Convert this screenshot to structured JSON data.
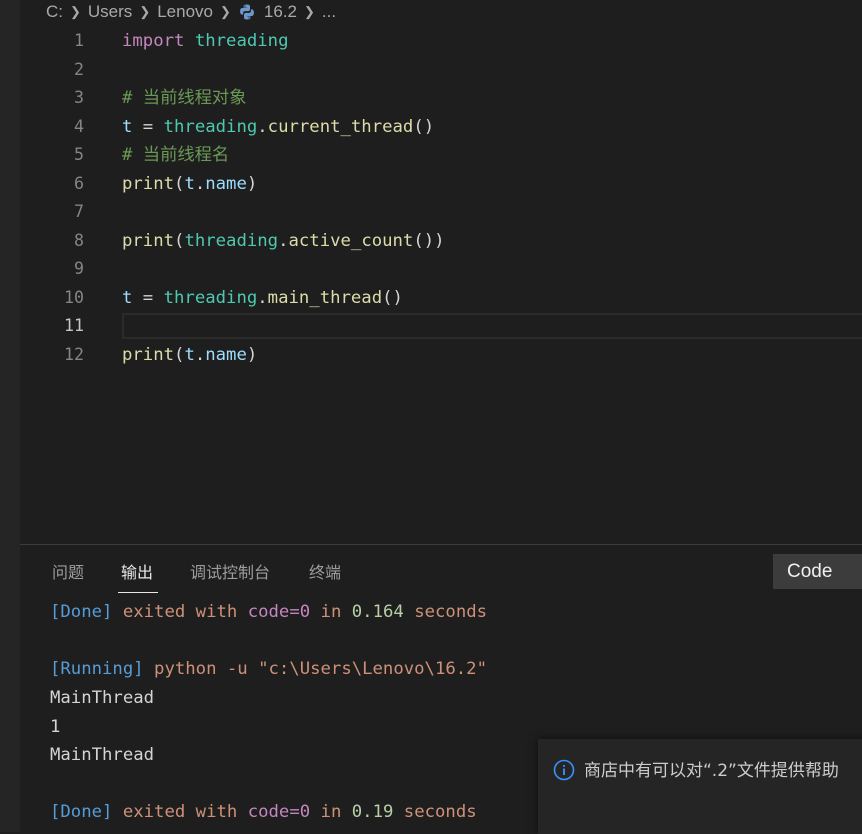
{
  "breadcrumb": {
    "items": [
      "C:",
      "Users",
      "Lenovo",
      "16.2",
      "..."
    ]
  },
  "editor": {
    "line_numbers": [
      "1",
      "2",
      "3",
      "4",
      "5",
      "6",
      "7",
      "8",
      "9",
      "10",
      "11",
      "12"
    ],
    "active_line": "11",
    "lines": {
      "l1": {
        "kw": "import",
        "mod": "threading"
      },
      "l3": {
        "comment": "# 当前线程对象"
      },
      "l4": {
        "var": "t",
        "eq": " = ",
        "mod": "threading",
        "dot": ".",
        "fn": "current_thread",
        "paren": "()"
      },
      "l5": {
        "comment": "# 当前线程名"
      },
      "l6": {
        "fn": "print",
        "open": "(",
        "var": "t",
        "dot": ".",
        "attr": "name",
        "close": ")"
      },
      "l8": {
        "fn": "print",
        "open": "(",
        "mod": "threading",
        "dot": ".",
        "fn2": "active_count",
        "close": "())"
      },
      "l10": {
        "var": "t",
        "eq": " = ",
        "mod": "threading",
        "dot": ".",
        "fn": "main_thread",
        "paren": "()"
      },
      "l12": {
        "fn": "print",
        "open": "(",
        "var": "t",
        "dot": ".",
        "attr": "name",
        "close": ")"
      }
    }
  },
  "panel": {
    "tabs": [
      "问题",
      "输出",
      "调试控制台",
      "终端"
    ],
    "active_tab": "输出",
    "channel_select": "Code",
    "output": {
      "done1": {
        "tag": "[Done]",
        "a": " exited with ",
        "code": "code=0",
        "in": " in ",
        "num": "0.164",
        "unit": " seconds"
      },
      "running": {
        "tag": "[Running]",
        "cmd": " python -u \"c:\\Users\\Lenovo\\16.2\""
      },
      "out1": "MainThread",
      "out2": "1",
      "out3": "MainThread",
      "done2": {
        "tag": "[Done]",
        "a": " exited with ",
        "code": "code=0",
        "in": " in ",
        "num": "0.19",
        "unit": " seconds"
      }
    }
  },
  "toast": {
    "icon": "info-icon",
    "message": "商店中有可以对“.2”文件提供帮助"
  },
  "colors": {
    "keyword": "#c586c0",
    "module": "#4ec9b0",
    "variable": "#9cdcfe",
    "function": "#dcdcaa",
    "comment": "#6a9955",
    "background": "#1e1e1e"
  }
}
